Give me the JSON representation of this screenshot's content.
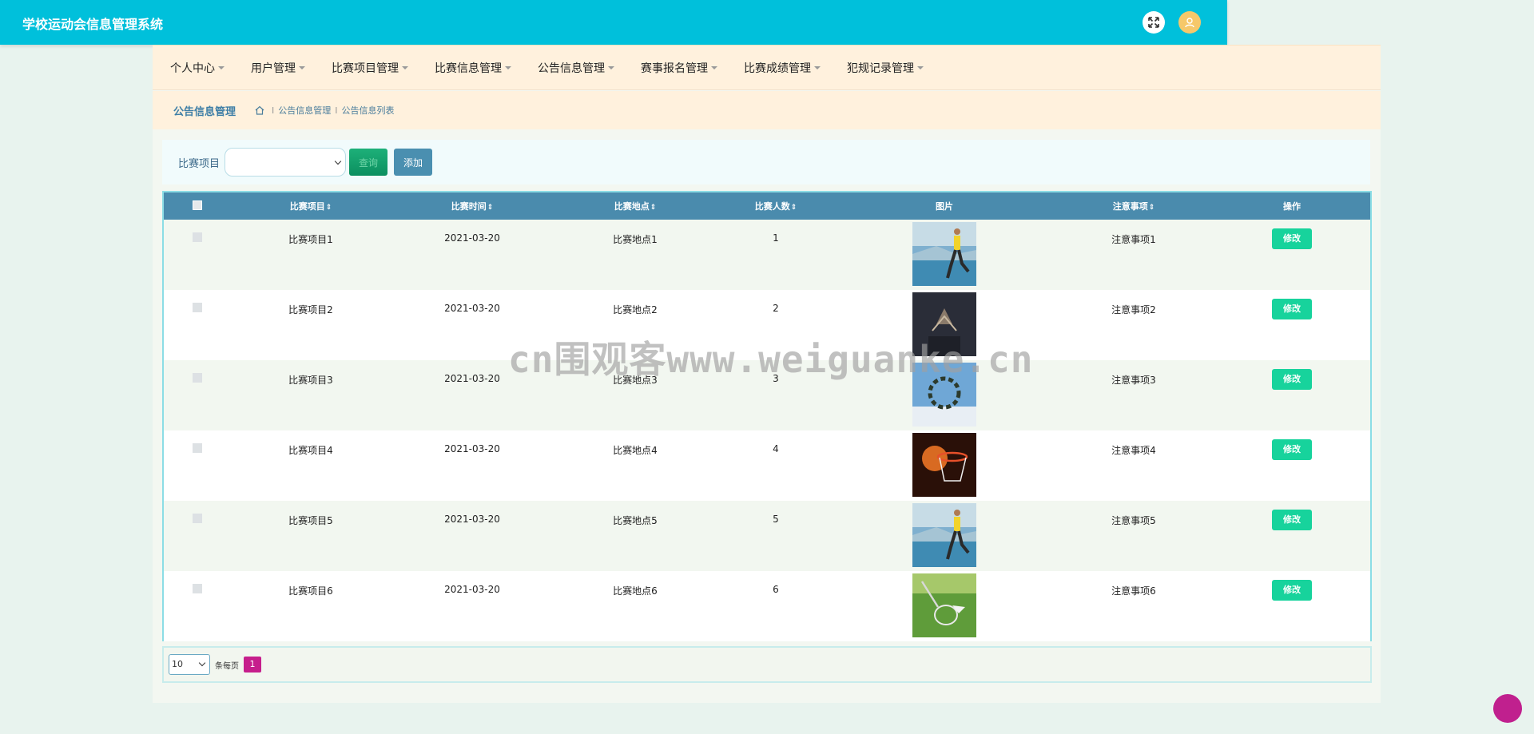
{
  "header": {
    "app_title": "学校运动会信息管理系统"
  },
  "nav": {
    "items": [
      {
        "label": "个人中心"
      },
      {
        "label": "用户管理"
      },
      {
        "label": "比赛项目管理"
      },
      {
        "label": "比赛信息管理"
      },
      {
        "label": "公告信息管理"
      },
      {
        "label": "赛事报名管理"
      },
      {
        "label": "比赛成绩管理"
      },
      {
        "label": "犯规记录管理"
      }
    ]
  },
  "breadcrumb": {
    "page_title": "公告信息管理",
    "items": [
      "公告信息管理",
      "公告信息列表"
    ],
    "separator": "I"
  },
  "search": {
    "label": "比赛项目",
    "search_button": "查询",
    "add_button": "添加"
  },
  "table": {
    "columns": [
      "比赛项目",
      "比赛时间",
      "比赛地点",
      "比赛人数",
      "图片",
      "注意事项",
      "操作"
    ],
    "sort_glyph": "⇕",
    "rows": [
      {
        "project": "比赛项目1",
        "time": "2021-03-20",
        "place": "比赛地点1",
        "count": "1",
        "image": "runner",
        "notes": "注意事项1",
        "action": "修改"
      },
      {
        "project": "比赛项目2",
        "time": "2021-03-20",
        "place": "比赛地点2",
        "count": "2",
        "image": "dark-sport",
        "notes": "注意事项2",
        "action": "修改"
      },
      {
        "project": "比赛项目3",
        "time": "2021-03-20",
        "place": "比赛地点3",
        "count": "3",
        "image": "skydivers",
        "notes": "注意事项3",
        "action": "修改"
      },
      {
        "project": "比赛项目4",
        "time": "2021-03-20",
        "place": "比赛地点4",
        "count": "4",
        "image": "basketball-hoop",
        "notes": "注意事项4",
        "action": "修改"
      },
      {
        "project": "比赛项目5",
        "time": "2021-03-20",
        "place": "比赛地点5",
        "count": "5",
        "image": "runner",
        "notes": "注意事项5",
        "action": "修改"
      },
      {
        "project": "比赛项目6",
        "time": "2021-03-20",
        "place": "比赛地点6",
        "count": "6",
        "image": "badminton",
        "notes": "注意事项6",
        "action": "修改"
      }
    ]
  },
  "pager": {
    "page_size": "10",
    "per_page_label": "条每页",
    "current_page": "1"
  },
  "watermark": "cn围观客www.weiguanke.cn",
  "colors": {
    "header": "#00c0db",
    "navbar": "#fff1dd",
    "table_header": "#4a8bad",
    "edit_button": "#17d39c",
    "page_active": "#c61e8c"
  }
}
